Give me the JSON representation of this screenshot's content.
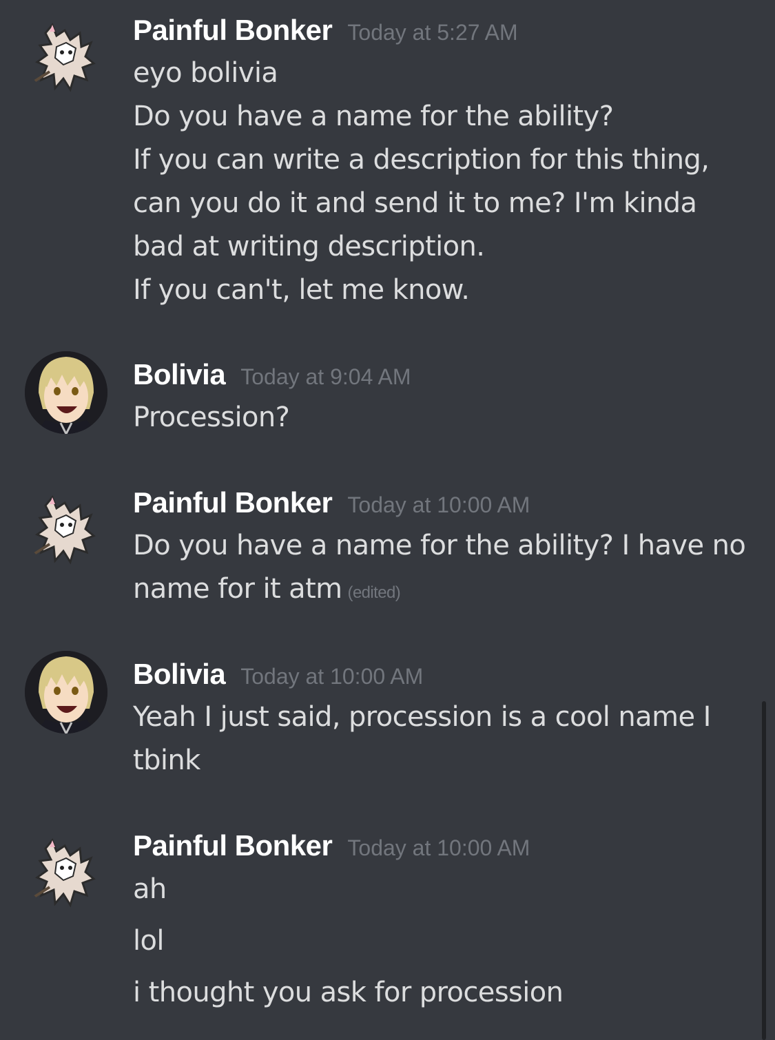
{
  "messages": [
    {
      "author": "Painful Bonker",
      "timestamp": "Today at 5:27 AM",
      "avatar_icon": "white-wolf-avatar",
      "lines": [
        "eyo bolivia",
        "Do you have a name for the ability?",
        "If you can write a description for this thing,",
        "can you do it and send it to me? I'm kinda",
        "bad at writing description.",
        "If you can't, let me know."
      ]
    },
    {
      "author": "Bolivia",
      "timestamp": "Today at 9:04 AM",
      "avatar_icon": "blond-anime-boy-avatar",
      "lines": [
        "Procession?"
      ]
    },
    {
      "author": "Painful Bonker",
      "timestamp": "Today at 10:00 AM",
      "avatar_icon": "white-wolf-avatar",
      "lines": [
        "Do you have a name for the ability? I have no",
        "name for it atm"
      ],
      "edited_label": "(edited)"
    },
    {
      "author": "Bolivia",
      "timestamp": "Today at 10:00 AM",
      "avatar_icon": "blond-anime-boy-avatar",
      "lines": [
        "Yeah I just said, procession is a cool name I",
        "tbink"
      ]
    },
    {
      "author": "Painful Bonker",
      "timestamp": "Today at 10:00 AM",
      "avatar_icon": "white-wolf-avatar",
      "lines": [
        "ah",
        "lol",
        "i thought you ask for procession"
      ]
    }
  ],
  "colors": {
    "background": "#36393f",
    "username": "#ffffff",
    "timestamp": "#72767d",
    "text": "#dcddde"
  }
}
